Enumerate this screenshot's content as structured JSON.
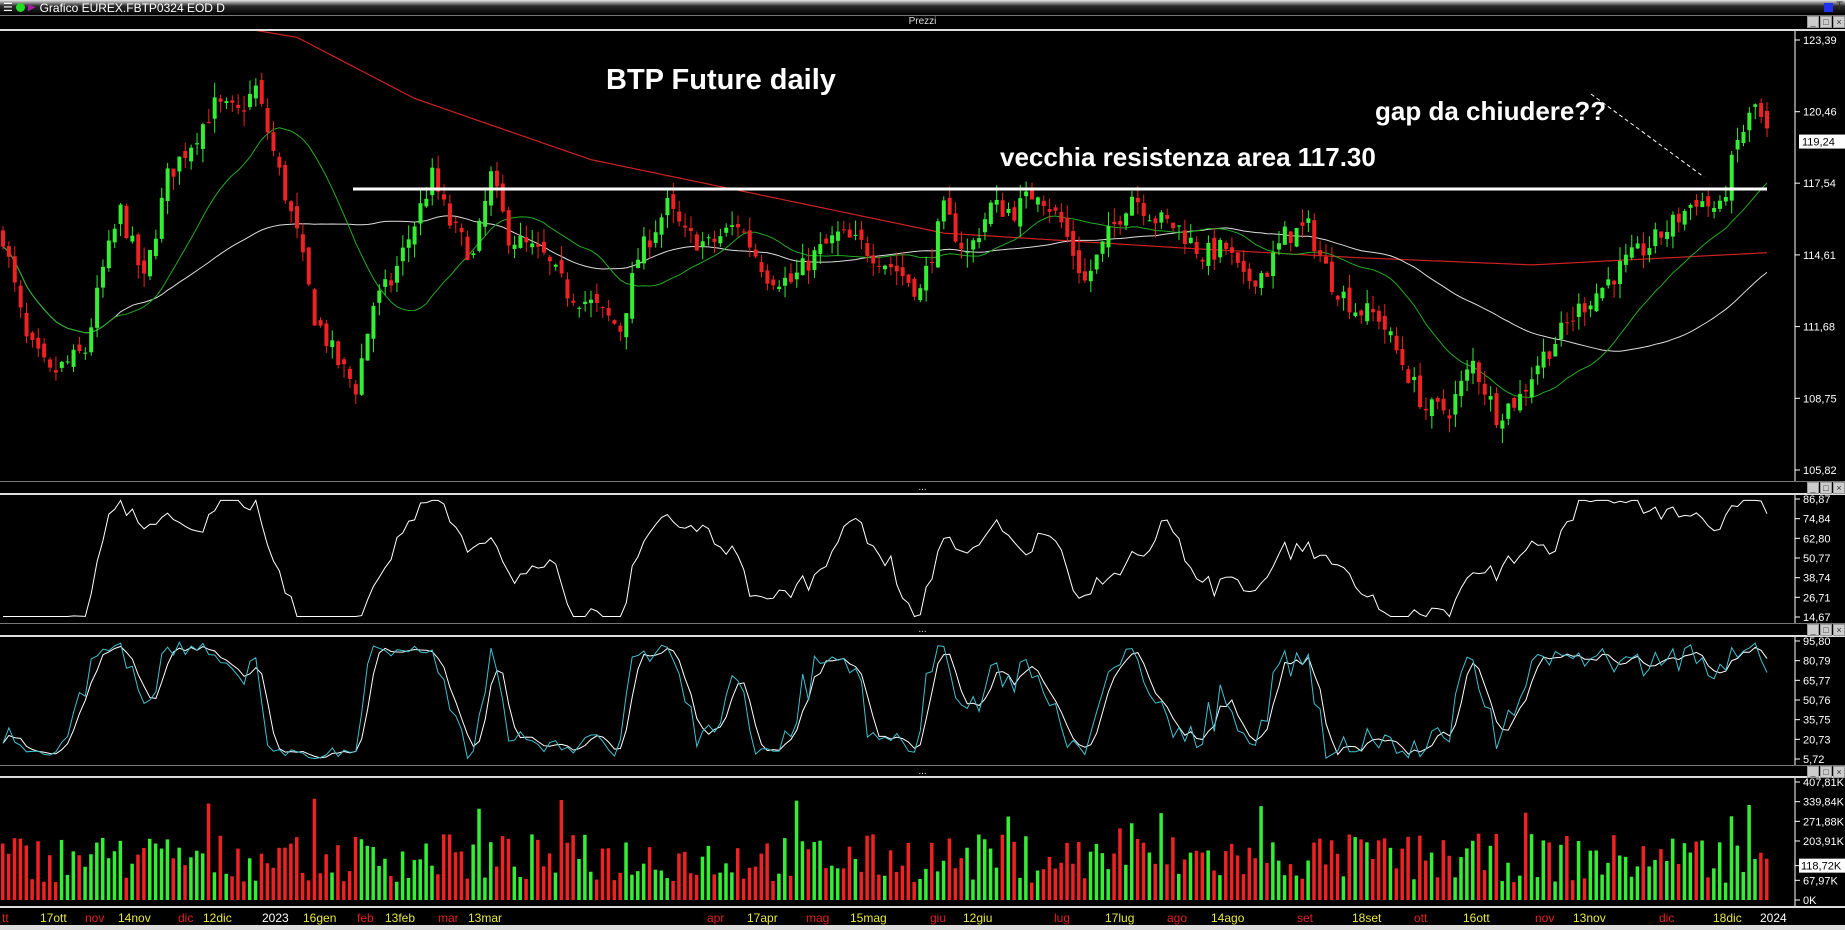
{
  "window": {
    "title": "Grafico EUREX.FBTP0324 EOD D",
    "menu_icon": "hamburger-icon",
    "status_color": "#22dd22",
    "accent_color": "#2233ee"
  },
  "panels": {
    "price_title": "Prezzi",
    "separator": "...",
    "window_buttons": [
      "_",
      "□",
      "×"
    ]
  },
  "annotations": {
    "title": "BTP Future daily",
    "resistance": "vecchia resistenza area 117.30",
    "gap": "gap da chiudere??"
  },
  "chart_data": [
    {
      "type": "candlestick",
      "title": "BTP Future daily",
      "symbol": "EUREX.FBTP0324",
      "ylim": [
        105.82,
        123.39
      ],
      "y_ticks": [
        "123,39",
        "120,46",
        "117,54",
        "114,61",
        "111,68",
        "108,75",
        "105,82"
      ],
      "last_price_label": "119,24",
      "resistance_level": 117.3,
      "close_path": [
        [
          0,
          115.4
        ],
        [
          4,
          111.1
        ],
        [
          8,
          109.7
        ],
        [
          14,
          110.7
        ],
        [
          17,
          114
        ],
        [
          20,
          116.4
        ],
        [
          24,
          113.5
        ],
        [
          28,
          117.8
        ],
        [
          32,
          119.2
        ],
        [
          36,
          120.7
        ],
        [
          40,
          120.4
        ],
        [
          43,
          121.4
        ],
        [
          46,
          118.8
        ],
        [
          50,
          115.4
        ],
        [
          53,
          112.1
        ],
        [
          57,
          110.2
        ],
        [
          60,
          109.2
        ],
        [
          63,
          112.6
        ],
        [
          66,
          113.5
        ],
        [
          70,
          115.9
        ],
        [
          73,
          117.8
        ],
        [
          76,
          115.9
        ],
        [
          80,
          114.5
        ],
        [
          83,
          117.8
        ],
        [
          86,
          115.4
        ],
        [
          92,
          114.5
        ],
        [
          96,
          113.1
        ],
        [
          100,
          112.6
        ],
        [
          105,
          111.6
        ],
        [
          108,
          114.5
        ],
        [
          113,
          116.6
        ],
        [
          116,
          115.4
        ],
        [
          120,
          115
        ],
        [
          125,
          115.9
        ],
        [
          130,
          113.8
        ],
        [
          134,
          113.5
        ],
        [
          138,
          114.6
        ],
        [
          142,
          115.4
        ],
        [
          146,
          115
        ],
        [
          152,
          114
        ],
        [
          156,
          113.1
        ],
        [
          160,
          116.4
        ],
        [
          164,
          114.6
        ],
        [
          168,
          116.6
        ],
        [
          172,
          116.4
        ],
        [
          176,
          117.3
        ],
        [
          180,
          115.9
        ],
        [
          184,
          113.5
        ],
        [
          188,
          115.4
        ],
        [
          192,
          117.1
        ],
        [
          196,
          116.1
        ],
        [
          200,
          115.7
        ],
        [
          204,
          114.6
        ],
        [
          208,
          114.9
        ],
        [
          211,
          113.5
        ],
        [
          215,
          114
        ],
        [
          218,
          115.4
        ],
        [
          222,
          115.7
        ],
        [
          226,
          113.5
        ],
        [
          230,
          112.4
        ],
        [
          234,
          112.1
        ],
        [
          238,
          110.2
        ],
        [
          242,
          108.3
        ],
        [
          246,
          108.3
        ],
        [
          250,
          110.2
        ],
        [
          254,
          108.1
        ],
        [
          258,
          108.8
        ],
        [
          261,
          110.2
        ],
        [
          264,
          111.1
        ],
        [
          268,
          112.4
        ],
        [
          272,
          113.3
        ],
        [
          276,
          114.3
        ],
        [
          280,
          115
        ],
        [
          284,
          115.9
        ],
        [
          288,
          116.9
        ],
        [
          292,
          116.4
        ],
        [
          295,
          119.2
        ],
        [
          298,
          120.7
        ],
        [
          300,
          119.5
        ]
      ],
      "ma200_path": [
        [
          0,
          125.5
        ],
        [
          50,
          123.5
        ],
        [
          70,
          121
        ],
        [
          100,
          118.5
        ],
        [
          130,
          117
        ],
        [
          160,
          115.5
        ],
        [
          200,
          114.9
        ],
        [
          230,
          114.5
        ],
        [
          260,
          114.2
        ],
        [
          300,
          114.7
        ]
      ],
      "series_colors": {
        "up": "#33ee33",
        "down": "#ee2222",
        "ma_fast": "#22aa22",
        "ma_mid": "#dddddd",
        "ma200": "#cc2222"
      }
    },
    {
      "type": "line",
      "name": "RSI",
      "ylim": [
        14.67,
        86.87
      ],
      "y_ticks": [
        "86,87",
        "74,84",
        "62,80",
        "50,77",
        "38,74",
        "26,71",
        "14,67"
      ]
    },
    {
      "type": "line",
      "name": "Stochastic",
      "ylim": [
        5.72,
        95.8
      ],
      "y_ticks": [
        "95,80",
        "80,79",
        "65,77",
        "50,76",
        "35,75",
        "20,73",
        "5,72"
      ]
    },
    {
      "type": "bar",
      "name": "Volume",
      "ylim": [
        0,
        407.81
      ],
      "y_ticks": [
        "407,81K",
        "339,84K",
        "271,88K",
        "203,91K",
        "118,72K",
        "67,97K",
        "0K"
      ],
      "last_volume_label": "118,72K"
    }
  ],
  "x_axis_labels": [
    {
      "label": "tt",
      "kind": "month"
    },
    {
      "label": "17ott",
      "kind": "day"
    },
    {
      "label": "nov",
      "kind": "month"
    },
    {
      "label": "14nov",
      "kind": "day"
    },
    {
      "label": "dic",
      "kind": "month"
    },
    {
      "label": "12dic",
      "kind": "day"
    },
    {
      "label": "2023",
      "kind": "year"
    },
    {
      "label": "16gen",
      "kind": "day"
    },
    {
      "label": "feb",
      "kind": "month"
    },
    {
      "label": "13feb",
      "kind": "day"
    },
    {
      "label": "mar",
      "kind": "month"
    },
    {
      "label": "13mar",
      "kind": "day"
    },
    {
      "label": "apr",
      "kind": "month"
    },
    {
      "label": "17apr",
      "kind": "day"
    },
    {
      "label": "mag",
      "kind": "month"
    },
    {
      "label": "15mag",
      "kind": "day"
    },
    {
      "label": "giu",
      "kind": "month"
    },
    {
      "label": "12giu",
      "kind": "day"
    },
    {
      "label": "lug",
      "kind": "month"
    },
    {
      "label": "17lug",
      "kind": "day"
    },
    {
      "label": "ago",
      "kind": "month"
    },
    {
      "label": "14ago",
      "kind": "day"
    },
    {
      "label": "set",
      "kind": "month"
    },
    {
      "label": "18set",
      "kind": "day"
    },
    {
      "label": "ott",
      "kind": "month"
    },
    {
      "label": "16ott",
      "kind": "day"
    },
    {
      "label": "nov",
      "kind": "month"
    },
    {
      "label": "13nov",
      "kind": "day"
    },
    {
      "label": "dic",
      "kind": "month"
    },
    {
      "label": "18dic",
      "kind": "day"
    },
    {
      "label": "2024",
      "kind": "year"
    }
  ]
}
